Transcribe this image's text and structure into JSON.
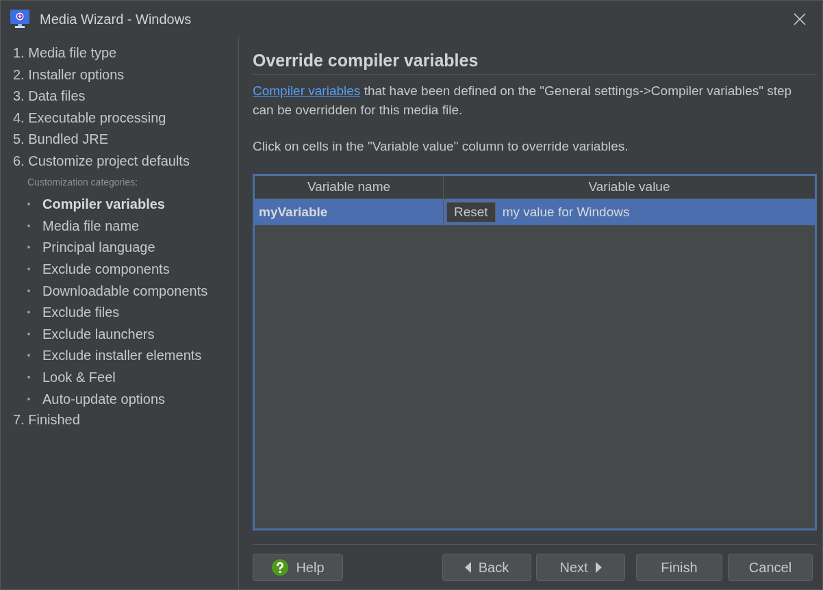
{
  "window": {
    "title": "Media Wizard - Windows"
  },
  "sidebar": {
    "steps": [
      {
        "label": "1. Media file type"
      },
      {
        "label": "2. Installer options"
      },
      {
        "label": "3. Data files"
      },
      {
        "label": "4. Executable processing"
      },
      {
        "label": "5. Bundled JRE"
      },
      {
        "label": "6. Customize project defaults",
        "categories_label": "Customization categories:",
        "children": [
          {
            "label": "Compiler variables",
            "selected": true
          },
          {
            "label": "Media file name",
            "selected": false
          },
          {
            "label": "Principal language",
            "selected": false
          },
          {
            "label": "Exclude components",
            "selected": false
          },
          {
            "label": "Downloadable components",
            "selected": false
          },
          {
            "label": "Exclude files",
            "selected": false
          },
          {
            "label": "Exclude launchers",
            "selected": false
          },
          {
            "label": "Exclude installer elements",
            "selected": false
          },
          {
            "label": "Look & Feel",
            "selected": false
          },
          {
            "label": "Auto-update options",
            "selected": false
          }
        ]
      },
      {
        "label": "7. Finished"
      }
    ]
  },
  "main": {
    "heading": "Override compiler variables",
    "link": "Compiler variables",
    "description": "that have been defined on the \"General settings->Compiler variables\" step can be overridden for this media file.",
    "hint": "Click on cells in the \"Variable value\" column to override variables.",
    "table": {
      "columns": [
        "Variable name",
        "Variable value"
      ],
      "rows": [
        {
          "name": "myVariable",
          "selected": true,
          "reset_button": "Reset",
          "value": "my value for Windows"
        }
      ]
    }
  },
  "buttons": [
    {
      "kind": "help",
      "label": "Help"
    },
    {
      "kind": "back",
      "label": "Back"
    },
    {
      "kind": "next",
      "label": "Next"
    },
    {
      "kind": "plain",
      "label": "Finish"
    },
    {
      "kind": "plain",
      "label": "Cancel"
    }
  ]
}
